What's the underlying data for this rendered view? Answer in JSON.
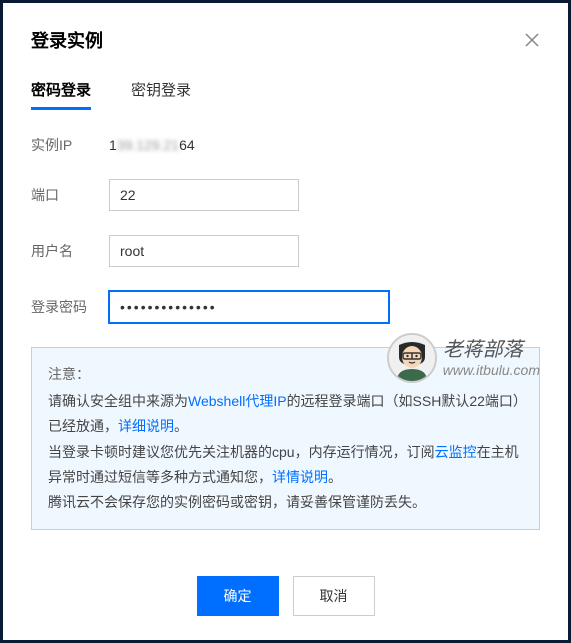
{
  "modal": {
    "title": "登录实例"
  },
  "tabs": {
    "password": "密码登录",
    "key": "密钥登录"
  },
  "form": {
    "instanceIp": {
      "label": "实例IP",
      "valuePrefix": "1",
      "valueBlur": "39.129.21",
      "valueSuffix": "64"
    },
    "port": {
      "label": "端口",
      "value": "22"
    },
    "username": {
      "label": "用户名",
      "value": "root"
    },
    "password": {
      "label": "登录密码",
      "value": "••••••••••••••"
    }
  },
  "notice": {
    "title": "注意：",
    "line1a": "请确认安全组中来源为",
    "link1": "Webshell代理IP",
    "line1b": "的远程登录端口（如SSH默认22端口）已经放通，",
    "link2": "详细说明",
    "line1c": "。",
    "line2a": "当登录卡顿时建议您优先关注机器的cpu，内存运行情况，订阅",
    "link3": "云监控",
    "line2b": "在主机异常时通过短信等多种方式通知您，",
    "link4": "详情说明",
    "line2c": "。",
    "line3": "腾讯云不会保存您的实例密码或密钥，请妥善保管谨防丢失。"
  },
  "footer": {
    "confirm": "确定",
    "cancel": "取消"
  },
  "watermark": {
    "title": "老蒋部落",
    "url": "www.itbulu.com"
  }
}
